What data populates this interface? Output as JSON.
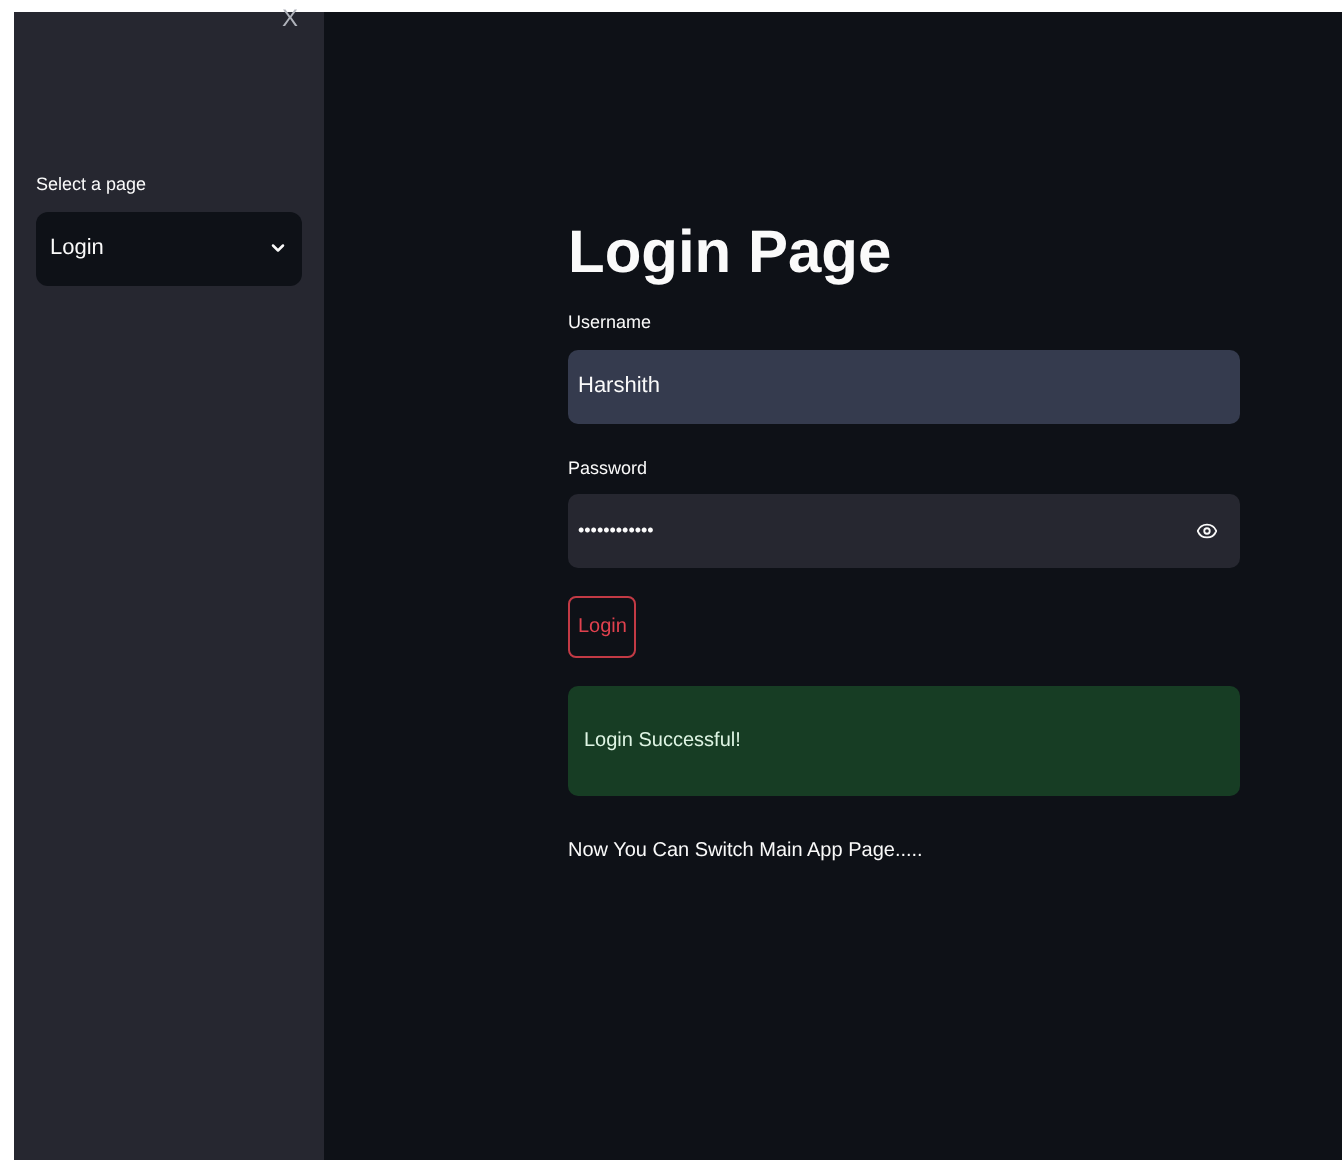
{
  "sidebar": {
    "close": "X",
    "select_label": "Select a page",
    "select_value": "Login"
  },
  "main": {
    "title": "Login Page",
    "username": {
      "label": "Username",
      "value": "Harshith"
    },
    "password": {
      "label": "Password",
      "value": "••••••••••••"
    },
    "login_button": "Login",
    "success": "Login Successful!",
    "note": "Now You Can Switch Main App Page....."
  }
}
